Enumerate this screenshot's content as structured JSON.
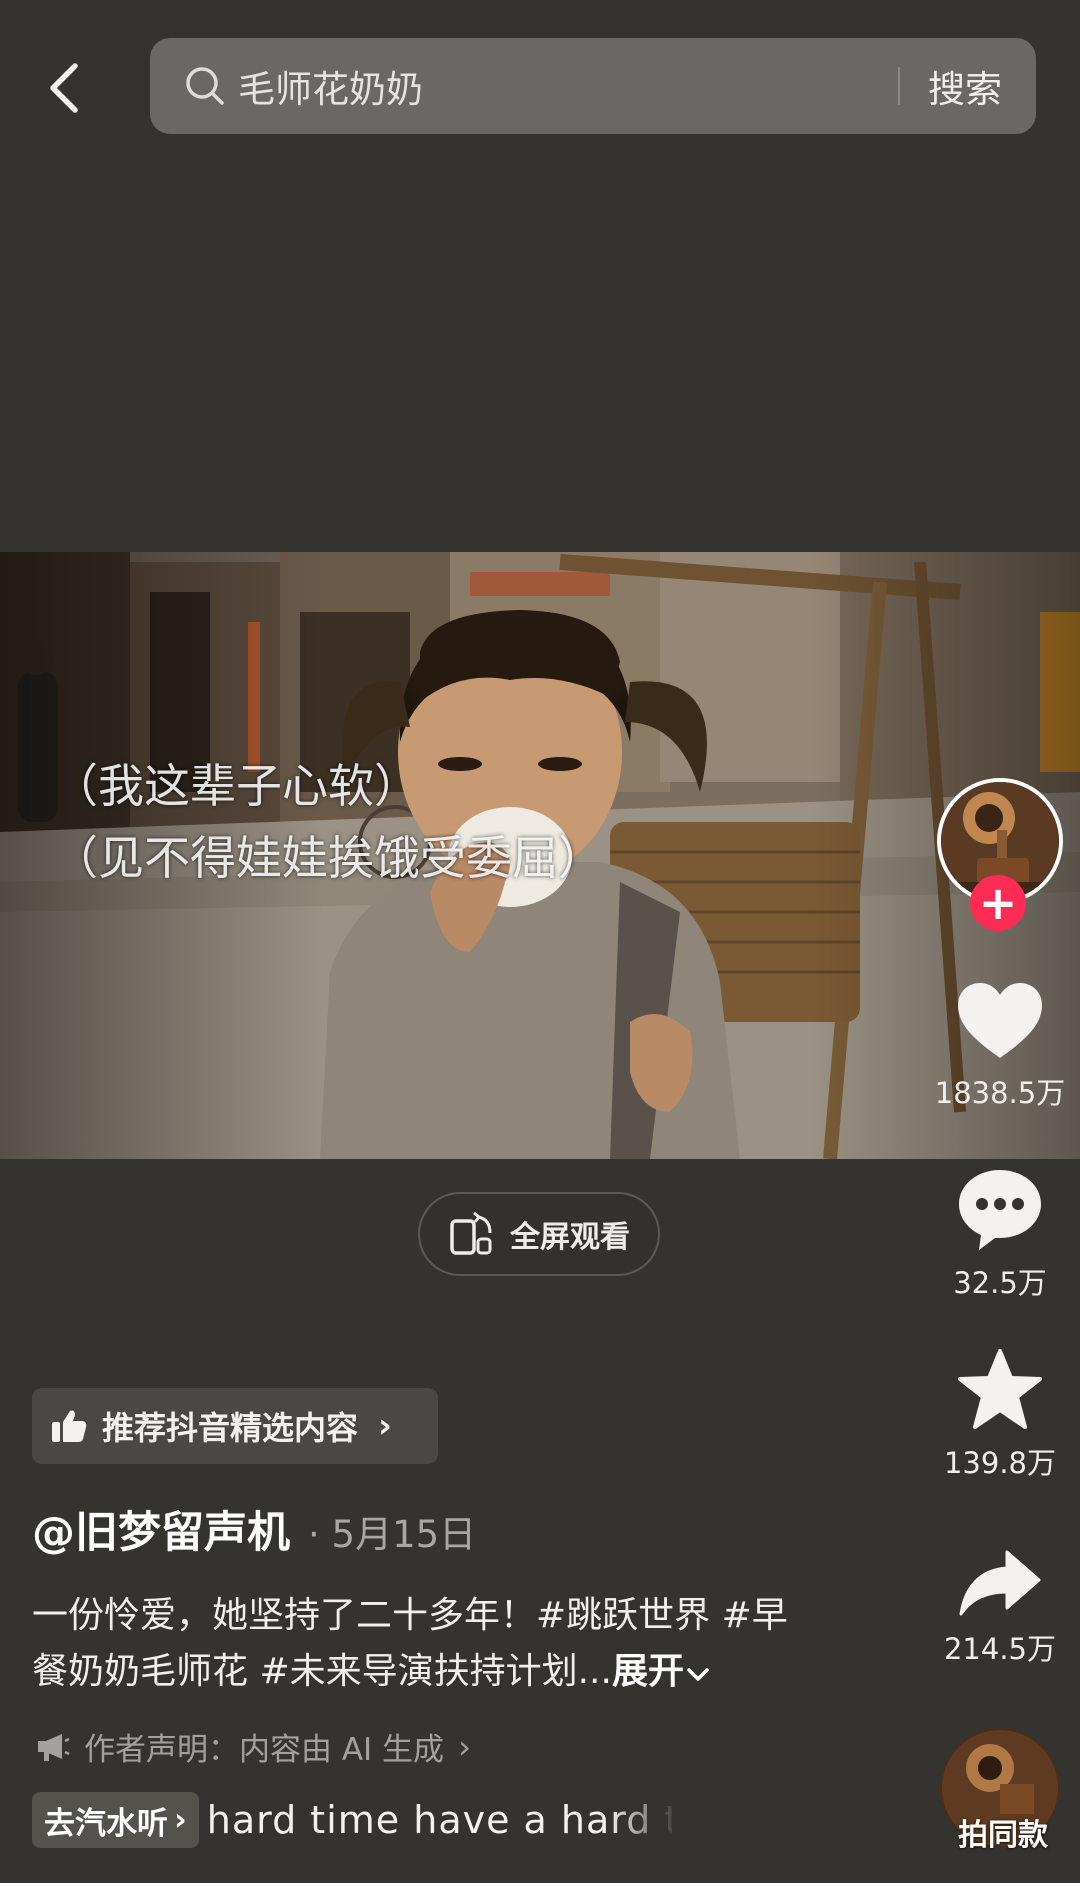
{
  "header": {
    "search_query": "毛师花奶奶",
    "search_button": "搜索"
  },
  "video": {
    "subtitles": [
      "（我这辈子心软）",
      "（见不得娃娃挨饿受委屈）"
    ],
    "fullscreen_label": "全屏观看"
  },
  "actions": {
    "likes": "1838.5万",
    "comments": "32.5万",
    "favorites": "139.8万",
    "shares": "214.5万",
    "same_style": "拍同款"
  },
  "info": {
    "recommend_label": "推荐抖音精选内容",
    "author": "@旧梦留声机",
    "date_separator": "·",
    "date": "5月15日",
    "caption": "一份怜爱，她坚持了二十多年！#跳跃世界 #早餐奶奶毛师花 #未来导演扶持计划...",
    "expand_label": "展开",
    "ai_notice": "作者声明：内容由 AI 生成",
    "music_chip": "去汽水听",
    "music_scroll": "hard time  have a hard t"
  },
  "colors": {
    "background": "#353330",
    "search_bar": "#6a6864",
    "follow_accent": "#fe2c55",
    "chip": "#4a4845"
  }
}
